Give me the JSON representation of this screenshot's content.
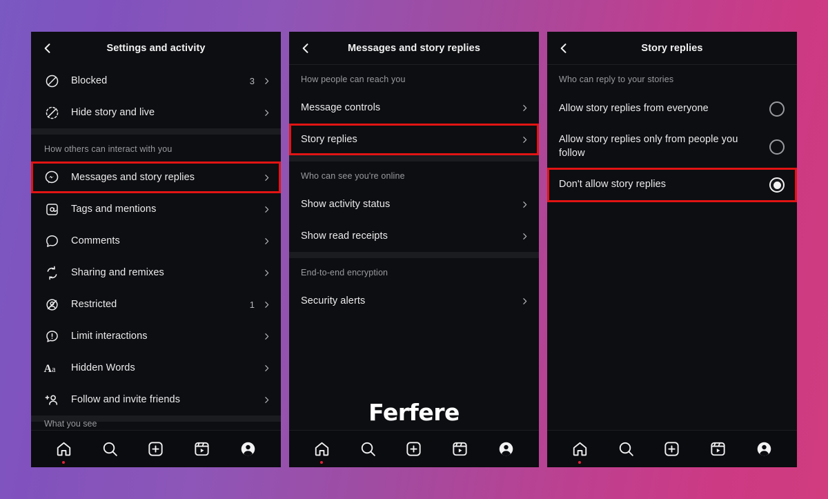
{
  "background": {
    "from": "#7a59c2",
    "to": "#d03c7e"
  },
  "highlight_color": "#e21414",
  "watermark": "Ferfere",
  "panels": [
    {
      "title": "Settings and activity",
      "back_icon": "chevron-left-icon",
      "sections": [
        {
          "label": null,
          "rows": [
            {
              "icon": "blocked-icon",
              "label": "Blocked",
              "count": "3",
              "chevron": true,
              "highlighted": false
            },
            {
              "icon": "hide-story-icon",
              "label": "Hide story and live",
              "count": "",
              "chevron": true,
              "highlighted": false
            }
          ]
        },
        {
          "label": "How others can interact with you",
          "rows": [
            {
              "icon": "messenger-icon",
              "label": "Messages and story replies",
              "count": "",
              "chevron": true,
              "highlighted": true
            },
            {
              "icon": "at-icon",
              "label": "Tags and mentions",
              "count": "",
              "chevron": true,
              "highlighted": false
            },
            {
              "icon": "comment-icon",
              "label": "Comments",
              "count": "",
              "chevron": true,
              "highlighted": false
            },
            {
              "icon": "share-remix-icon",
              "label": "Sharing and remixes",
              "count": "",
              "chevron": true,
              "highlighted": false
            },
            {
              "icon": "restricted-icon",
              "label": "Restricted",
              "count": "1",
              "chevron": true,
              "highlighted": false
            },
            {
              "icon": "limit-interactions-icon",
              "label": "Limit interactions",
              "count": "",
              "chevron": true,
              "highlighted": false
            },
            {
              "icon": "hidden-words-icon",
              "label": "Hidden Words",
              "count": "",
              "chevron": true,
              "highlighted": false
            },
            {
              "icon": "follow-invite-icon",
              "label": "Follow and invite friends",
              "count": "",
              "chevron": true,
              "highlighted": false
            }
          ]
        }
      ],
      "cut_off_label": "What you see"
    },
    {
      "title": "Messages and story replies",
      "back_icon": "chevron-left-icon",
      "sections": [
        {
          "label": "How people can reach you",
          "rows": [
            {
              "icon": null,
              "label": "Message controls",
              "count": "",
              "chevron": true,
              "highlighted": false
            },
            {
              "icon": null,
              "label": "Story replies",
              "count": "",
              "chevron": true,
              "highlighted": true
            }
          ]
        },
        {
          "label": "Who can see you're online",
          "rows": [
            {
              "icon": null,
              "label": "Show activity status",
              "count": "",
              "chevron": true,
              "highlighted": false
            },
            {
              "icon": null,
              "label": "Show read receipts",
              "count": "",
              "chevron": true,
              "highlighted": false
            }
          ]
        },
        {
          "label": "End-to-end encryption",
          "rows": [
            {
              "icon": null,
              "label": "Security alerts",
              "count": "",
              "chevron": true,
              "highlighted": false
            }
          ]
        }
      ]
    },
    {
      "title": "Story replies",
      "back_icon": "chevron-left-icon",
      "sections": [
        {
          "label": "Who can reply to your stories",
          "radios": [
            {
              "label": "Allow story replies from everyone",
              "selected": false,
              "highlighted": false,
              "tall": false
            },
            {
              "label": "Allow story replies only from people you follow",
              "selected": false,
              "highlighted": false,
              "tall": true
            },
            {
              "label": "Don't allow story replies",
              "selected": true,
              "highlighted": true,
              "tall": false
            }
          ]
        }
      ]
    }
  ],
  "bottom_nav": {
    "items": [
      {
        "icon": "home-icon",
        "label": "Home",
        "active": true
      },
      {
        "icon": "search-icon",
        "label": "Search",
        "active": false
      },
      {
        "icon": "create-icon",
        "label": "Create",
        "active": false
      },
      {
        "icon": "reels-icon",
        "label": "Reels",
        "active": false
      },
      {
        "icon": "profile-icon",
        "label": "Profile",
        "active": false
      }
    ]
  }
}
